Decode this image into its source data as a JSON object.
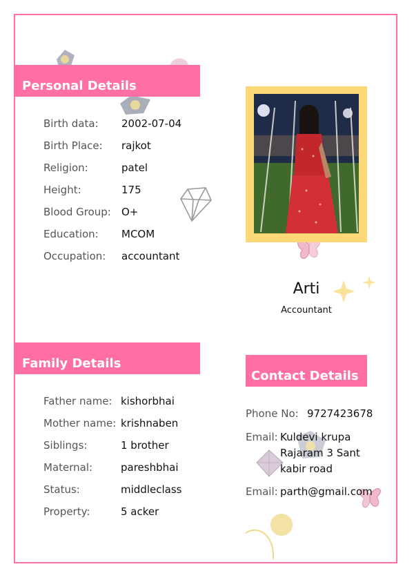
{
  "personal": {
    "title": "Personal Details",
    "rows": [
      {
        "label": "Birth data:",
        "value": "2002-07-04"
      },
      {
        "label": "Birth Place:",
        "value": "rajkot"
      },
      {
        "label": "Religion:",
        "value": "patel"
      },
      {
        "label": "Height:",
        "value": "175"
      },
      {
        "label": "Blood Group:",
        "value": "O+"
      },
      {
        "label": "Education:",
        "value": "MCOM"
      },
      {
        "label": "Occupation:",
        "value": "accountant"
      }
    ]
  },
  "profile": {
    "name": "Arti",
    "role": "Accountant"
  },
  "family": {
    "title": "Family Details",
    "rows": [
      {
        "label": "Father name:",
        "value": "kishorbhai"
      },
      {
        "label": "Mother name:",
        "value": "krishnaben"
      },
      {
        "label": "Siblings:",
        "value": "1 brother"
      },
      {
        "label": "Maternal:",
        "value": "pareshbhai"
      },
      {
        "label": "Status:",
        "value": "middleclass"
      },
      {
        "label": "Property:",
        "value": "5 acker"
      }
    ]
  },
  "contact": {
    "title": "Contact Details",
    "phone_label": "Phone No:",
    "phone_value": "9727423678",
    "address_label": "Email:",
    "address_lines": [
      "Kuldevi krupa",
      "Rajaram 3 Sant",
      "kabir road"
    ],
    "email_label": "Email:",
    "email_value": "parth@gmail.com"
  },
  "colors": {
    "accent": "#ff6fa3",
    "photo_frame": "#fcd878"
  }
}
